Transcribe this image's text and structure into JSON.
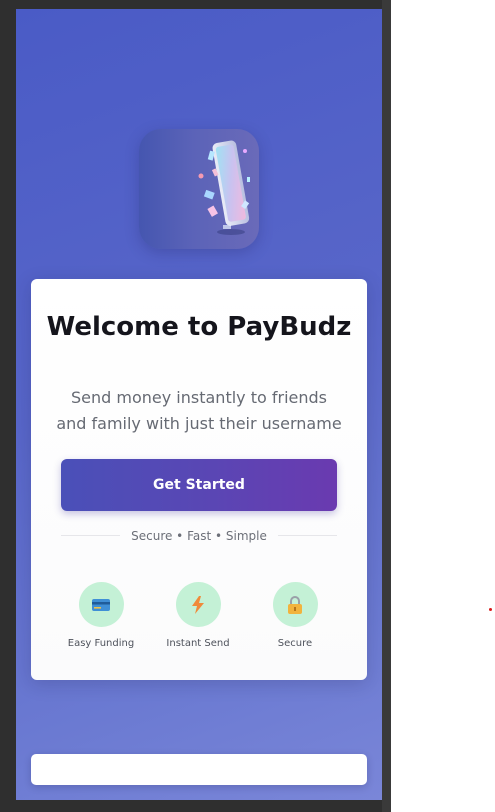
{
  "app": {
    "title": "Welcome to PayBudz",
    "subtitle": "Send money instantly to friends and family with just their username"
  },
  "cta": {
    "label": "Get Started"
  },
  "tagline": "Secure • Fast • Simple",
  "features": [
    {
      "label": "Easy Funding",
      "icon": "credit-card-icon"
    },
    {
      "label": "Instant Send",
      "icon": "lightning-icon"
    },
    {
      "label": "Secure",
      "icon": "lock-icon"
    }
  ],
  "colors": {
    "background_gradient_start": "#4a5bc6",
    "background_gradient_end": "#7a86d8",
    "button_start": "#4a50b8",
    "button_end": "#6a3ab0",
    "feature_circle": "#c4f1d6"
  }
}
